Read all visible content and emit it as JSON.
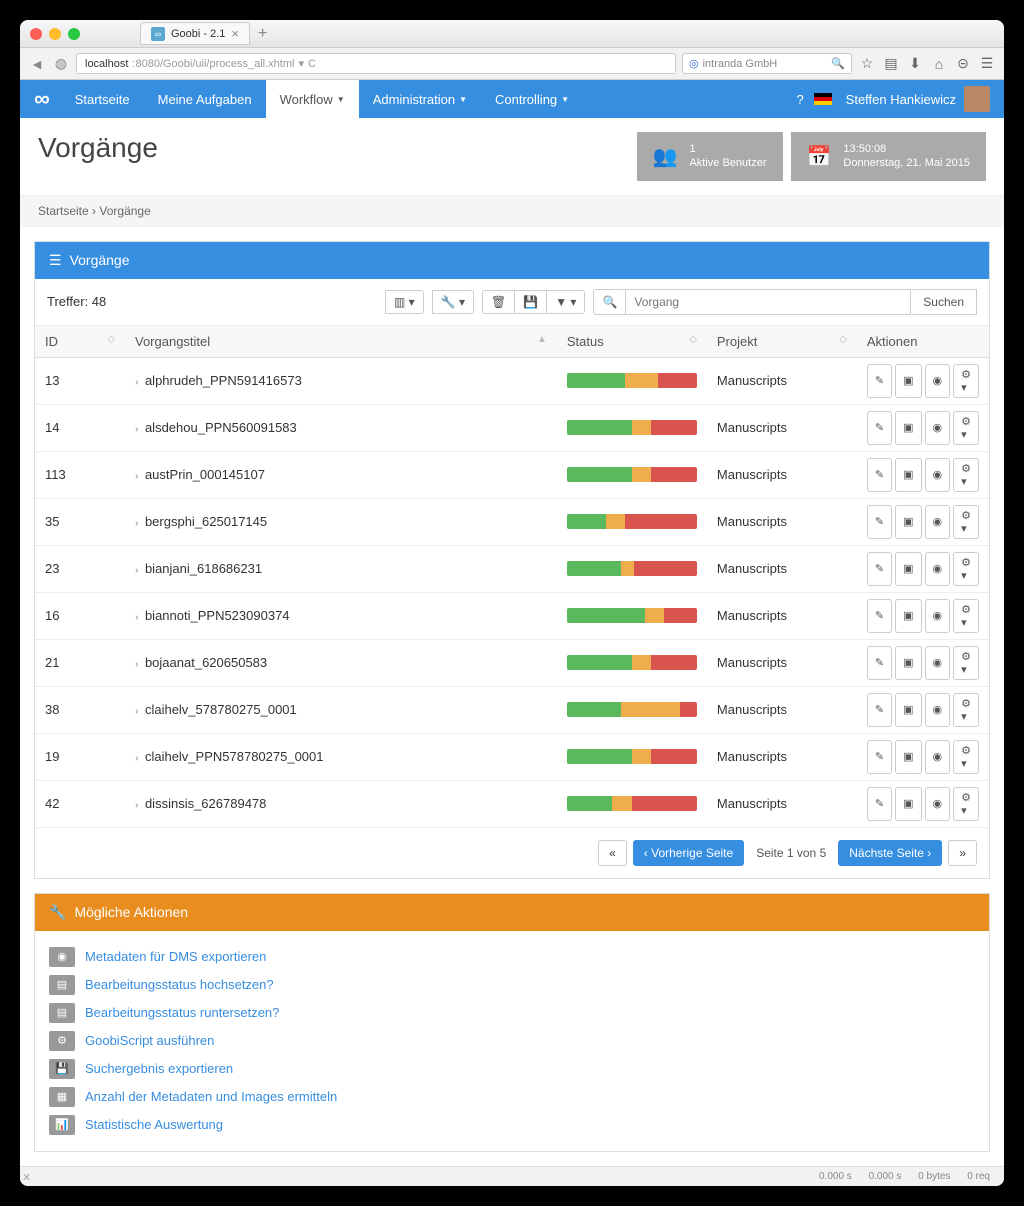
{
  "browser": {
    "tab_title": "Goobi - 2.1",
    "url_host": "localhost",
    "url_path": ":8080/Goobi/uii/process_all.xhtml",
    "search_engine": "intranda GmbH"
  },
  "nav": {
    "items": [
      "Startseite",
      "Meine Aufgaben",
      "Workflow",
      "Administration",
      "Controlling"
    ],
    "active_index": 2,
    "user": "Steffen Hankiewicz"
  },
  "page": {
    "title": "Vorgänge",
    "breadcrumb_home": "Startseite",
    "breadcrumb_current": "Vorgänge"
  },
  "stats": {
    "users_count": "1",
    "users_label": "Aktive Benutzer",
    "time": "13:50:08",
    "date": "Donnerstag, 21. Mai 2015"
  },
  "panel": {
    "title": "Vorgänge",
    "treffer_label": "Treffer: 48",
    "search_placeholder": "Vorgang",
    "search_button": "Suchen"
  },
  "columns": {
    "id": "ID",
    "title": "Vorgangstitel",
    "status": "Status",
    "project": "Projekt",
    "actions": "Aktionen"
  },
  "rows": [
    {
      "id": "13",
      "title": "alphrudeh_PPN591416573",
      "project": "Manuscripts",
      "g": 45,
      "y": 25,
      "r": 30
    },
    {
      "id": "14",
      "title": "alsdehou_PPN560091583",
      "project": "Manuscripts",
      "g": 50,
      "y": 15,
      "r": 35
    },
    {
      "id": "113",
      "title": "austPrin_000145107",
      "project": "Manuscripts",
      "g": 50,
      "y": 15,
      "r": 35
    },
    {
      "id": "35",
      "title": "bergsphi_625017145",
      "project": "Manuscripts",
      "g": 30,
      "y": 15,
      "r": 55
    },
    {
      "id": "23",
      "title": "bianjani_618686231",
      "project": "Manuscripts",
      "g": 42,
      "y": 10,
      "r": 48
    },
    {
      "id": "16",
      "title": "biannoti_PPN523090374",
      "project": "Manuscripts",
      "g": 60,
      "y": 15,
      "r": 25
    },
    {
      "id": "21",
      "title": "bojaanat_620650583",
      "project": "Manuscripts",
      "g": 50,
      "y": 15,
      "r": 35
    },
    {
      "id": "38",
      "title": "claihelv_578780275_0001",
      "project": "Manuscripts",
      "g": 42,
      "y": 45,
      "r": 13
    },
    {
      "id": "19",
      "title": "claihelv_PPN578780275_0001",
      "project": "Manuscripts",
      "g": 50,
      "y": 15,
      "r": 35
    },
    {
      "id": "42",
      "title": "dissinsis_626789478",
      "project": "Manuscripts",
      "g": 35,
      "y": 15,
      "r": 50
    }
  ],
  "pagination": {
    "prev": "Vorherige Seite",
    "info": "Seite 1 von 5",
    "next": "Nächste Seite"
  },
  "actions_panel": {
    "title": "Mögliche Aktionen",
    "items": [
      "Metadaten für DMS exportieren",
      "Bearbeitungsstatus hochsetzen?",
      "Bearbeitungsstatus runtersetzen?",
      "GoobiScript ausführen",
      "Suchergebnis exportieren",
      "Anzahl der Metadaten und Images ermitteln",
      "Statistische Auswertung"
    ],
    "icons": [
      "◉",
      "▤",
      "▤",
      "⚙",
      "💾",
      "▦",
      "📊"
    ]
  },
  "footer": {
    "s1": "0.000 s",
    "s2": "0.000 s",
    "s3": "0 bytes",
    "s4": "0 req"
  }
}
